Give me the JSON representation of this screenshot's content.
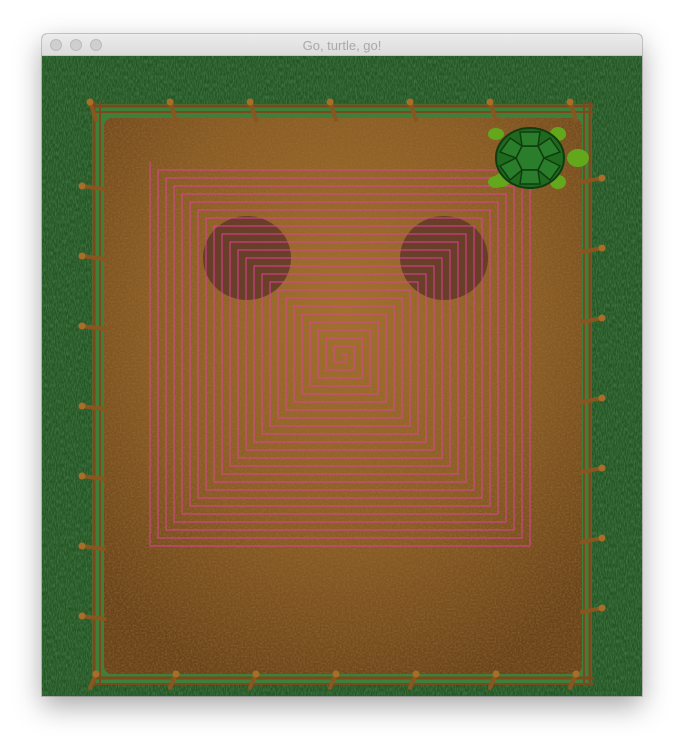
{
  "window": {
    "title": "Go, turtle, go!"
  },
  "colors": {
    "grass": "#245524",
    "dirt": "#8a5e26",
    "trail": "#e0409a",
    "turtle_shell": "#1f6a1f",
    "turtle_skin": "#63a81c",
    "fence": "#7a4a1c"
  },
  "scene": {
    "trail_shape": "square-spiral",
    "sprite": "turtle"
  }
}
